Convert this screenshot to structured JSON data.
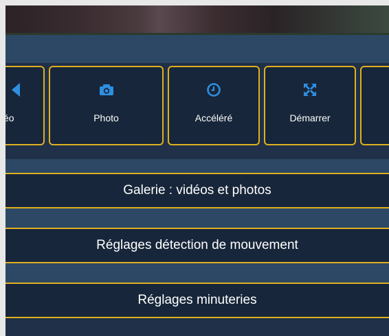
{
  "mode_buttons": [
    {
      "label": "éo",
      "icon": "video-icon"
    },
    {
      "label": "Photo",
      "icon": "camera-icon"
    },
    {
      "label": "Accéléré",
      "icon": "clock-icon"
    },
    {
      "label": "Démarrer",
      "icon": "expand-arrows-icon"
    },
    {
      "label": "",
      "icon": ""
    }
  ],
  "menu_buttons": [
    {
      "label": "Galerie : vidéos et photos"
    },
    {
      "label": "Réglages détection de mouvement"
    },
    {
      "label": "Réglages minuteries"
    }
  ],
  "colors": {
    "accent_border": "#e0b020",
    "icon_blue": "#2f8fe0",
    "button_bg": "#17263a",
    "panel_bg": "#2e4a64"
  }
}
